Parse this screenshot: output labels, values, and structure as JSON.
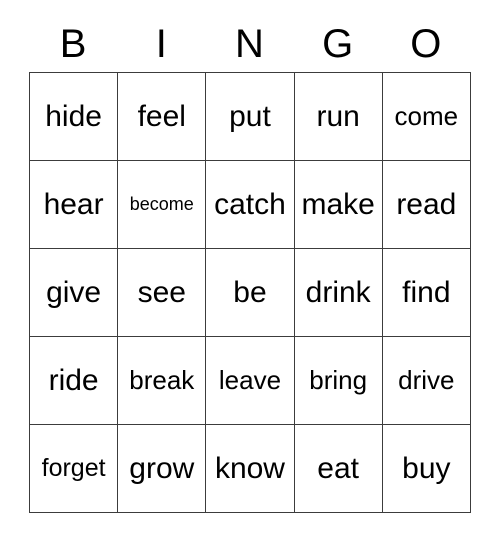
{
  "card": {
    "headers": [
      "B",
      "I",
      "N",
      "G",
      "O"
    ],
    "grid": [
      [
        {
          "word": "hide",
          "size": "lg"
        },
        {
          "word": "feel",
          "size": "lg"
        },
        {
          "word": "put",
          "size": "lg"
        },
        {
          "word": "run",
          "size": "lg"
        },
        {
          "word": "come",
          "size": "md"
        }
      ],
      [
        {
          "word": "hear",
          "size": "lg"
        },
        {
          "word": "become",
          "size": "xs"
        },
        {
          "word": "catch",
          "size": "lg"
        },
        {
          "word": "make",
          "size": "lg"
        },
        {
          "word": "read",
          "size": "lg"
        }
      ],
      [
        {
          "word": "give",
          "size": "lg"
        },
        {
          "word": "see",
          "size": "lg"
        },
        {
          "word": "be",
          "size": "lg"
        },
        {
          "word": "drink",
          "size": "lg"
        },
        {
          "word": "find",
          "size": "lg"
        }
      ],
      [
        {
          "word": "ride",
          "size": "lg"
        },
        {
          "word": "break",
          "size": "md"
        },
        {
          "word": "leave",
          "size": "md"
        },
        {
          "word": "bring",
          "size": "md"
        },
        {
          "word": "drive",
          "size": "md"
        }
      ],
      [
        {
          "word": "forget",
          "size": "sm"
        },
        {
          "word": "grow",
          "size": "lg"
        },
        {
          "word": "know",
          "size": "lg"
        },
        {
          "word": "eat",
          "size": "lg"
        },
        {
          "word": "buy",
          "size": "lg"
        }
      ]
    ]
  },
  "colors": {
    "text": "#000000",
    "border": "#3c3c3c",
    "background": "#ffffff"
  }
}
